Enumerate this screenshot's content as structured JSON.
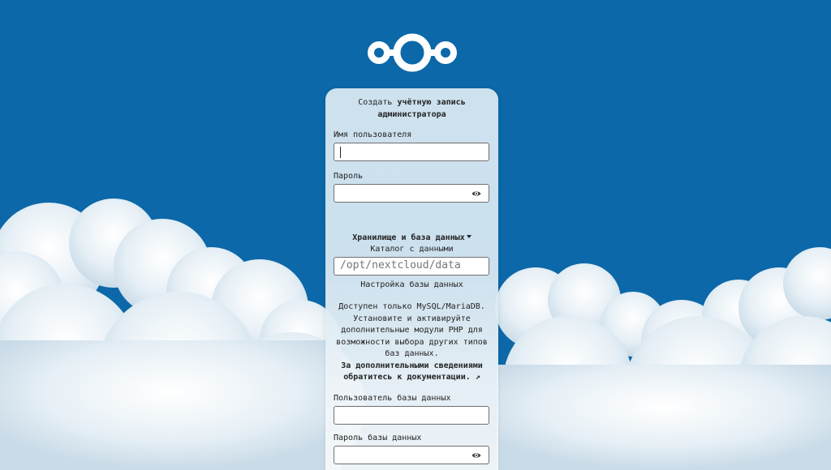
{
  "setup": {
    "title_prefix": "Создать",
    "title_bold": "учётную запись администратора",
    "username_label": "Имя пользователя",
    "password_label": "Пароль",
    "storage_toggle": "Хранилище и база данных",
    "data_dir_label": "Каталог с данными",
    "data_dir_value": "/opt/nextcloud/data",
    "db_config_label": "Настройка базы данных",
    "db_notice": "Доступен только MySQL/MariaDB. Установите и активируйте дополнительные модули PHP для возможности выбора других типов баз данных.",
    "docs_link": "За дополнительными сведениями обратитесь к документации. ↗",
    "db_user_label": "Пользователь базы данных",
    "db_password_label": "Пароль базы данных"
  },
  "icons": {
    "logo": "nextcloud-logo",
    "password_toggle": "eye-icon",
    "dropdown": "triangle-down-icon"
  },
  "colors": {
    "background": "#0c68a8",
    "card": "#d6e7f1",
    "input_border": "#707070"
  }
}
